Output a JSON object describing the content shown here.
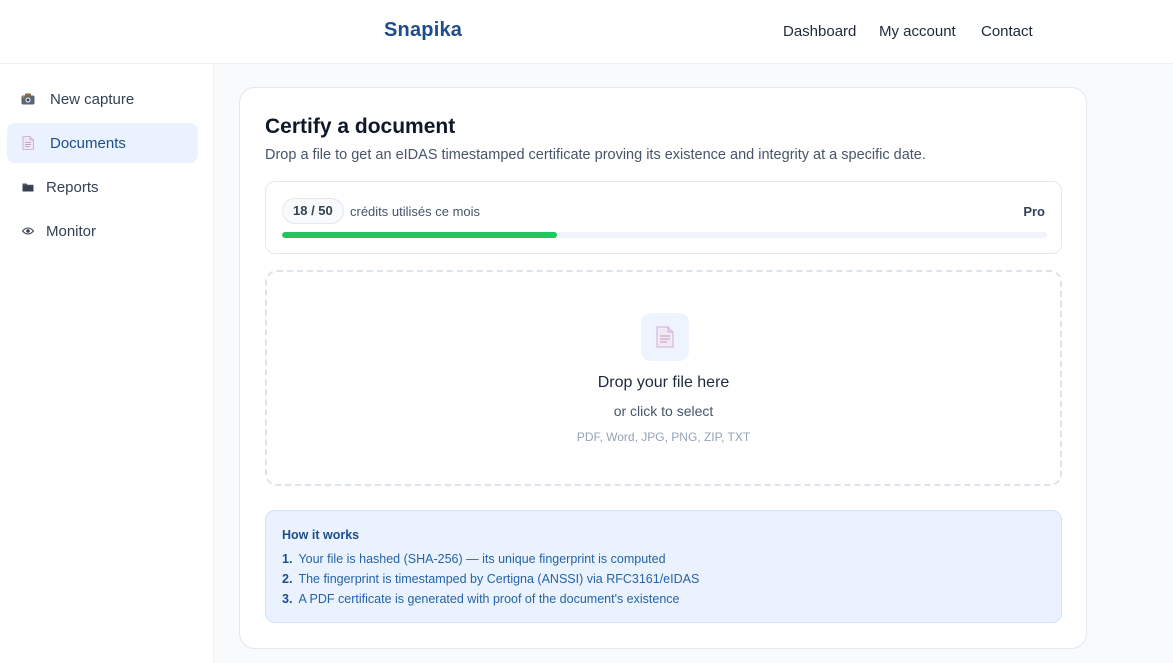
{
  "app": {
    "logo": "Snapika"
  },
  "nav": {
    "dashboard": "Dashboard",
    "my_account": "My account",
    "contact": "Contact"
  },
  "sidebar": {
    "items": [
      {
        "label": "New capture",
        "icon": "camera-icon",
        "active": false
      },
      {
        "label": "Documents",
        "icon": "document-icon",
        "active": true
      },
      {
        "label": "Reports",
        "icon": "folder-icon",
        "active": false
      },
      {
        "label": "Monitor",
        "icon": "eye-icon",
        "active": false
      }
    ]
  },
  "main": {
    "title": "Certify a document",
    "subtitle": "Drop a file to get an eIDAS timestamped certificate proving its existence and integrity at a specific date.",
    "credits": {
      "count": "18 / 50",
      "label": "crédits utilisés ce mois",
      "plan": "Pro",
      "used": 18,
      "total": 50
    },
    "dropzone": {
      "icon": "document-icon",
      "title": "Drop your file here",
      "subtitle": "or click to select",
      "types": "PDF, Word, JPG, PNG, ZIP, TXT"
    },
    "how": {
      "title": "How it works",
      "steps": [
        {
          "num": "1.",
          "text": "Your file is hashed (SHA-256) — its unique fingerprint is computed"
        },
        {
          "num": "2.",
          "text": "The fingerprint is timestamped by Certigna (ANSSI) via RFC3161/eIDAS"
        },
        {
          "num": "3.",
          "text": "A PDF certificate is generated with proof of the document's existence"
        }
      ]
    }
  },
  "colors": {
    "brand": "#1e4d8c",
    "progress": "#22c55e",
    "info_bg": "#eaf3fd",
    "active_bg": "#eaf3fd"
  }
}
